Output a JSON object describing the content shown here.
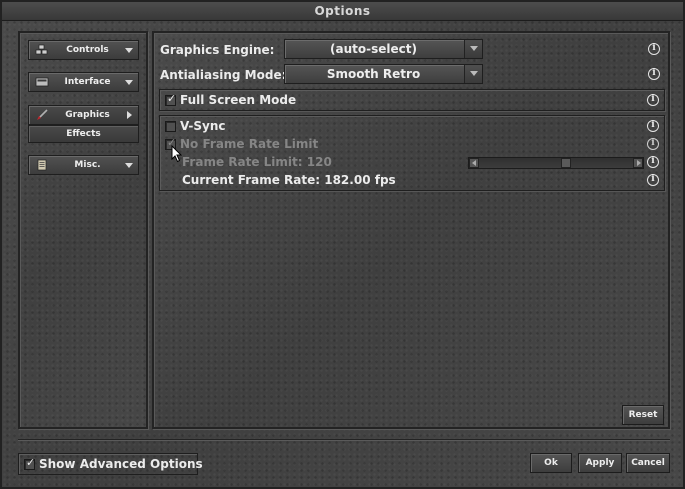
{
  "window": {
    "title": "Options"
  },
  "sidebar": {
    "items": [
      {
        "label": "Controls",
        "icon": "controls-icon"
      },
      {
        "label": "Interface",
        "icon": "interface-icon"
      },
      {
        "label": "Graphics",
        "icon": "brush-icon",
        "active": true
      },
      {
        "label": "Misc.",
        "icon": "scroll-icon"
      }
    ],
    "subitem": {
      "label": "Effects"
    }
  },
  "main": {
    "graphics_engine": {
      "label": "Graphics Engine:",
      "value": "(auto-select)"
    },
    "antialiasing": {
      "label": "Antialiasing Mode:",
      "value": "Smooth Retro"
    },
    "fullscreen": {
      "label": "Full Screen Mode",
      "checked": true
    },
    "vsync": {
      "label": "V-Sync",
      "checked": false
    },
    "no_frame_limit": {
      "label": "No Frame Rate Limit",
      "checked": true,
      "disabled": true
    },
    "frame_limit": {
      "label": "Frame Rate Limit: 120",
      "disabled": true
    },
    "current_rate": {
      "label": "Current Frame Rate: 182.00 fps"
    },
    "reset_label": "Reset",
    "info_glyph": "i"
  },
  "footer": {
    "show_advanced": {
      "label": "Show Advanced Options",
      "checked": true
    },
    "ok_label": "Ok",
    "apply_label": "Apply",
    "cancel_label": "Cancel"
  },
  "glyphs": {
    "check": "✓"
  },
  "colors": {
    "text": "#ececec",
    "disabled_text": "#868686",
    "panel": "#444444",
    "border": "#232323"
  }
}
